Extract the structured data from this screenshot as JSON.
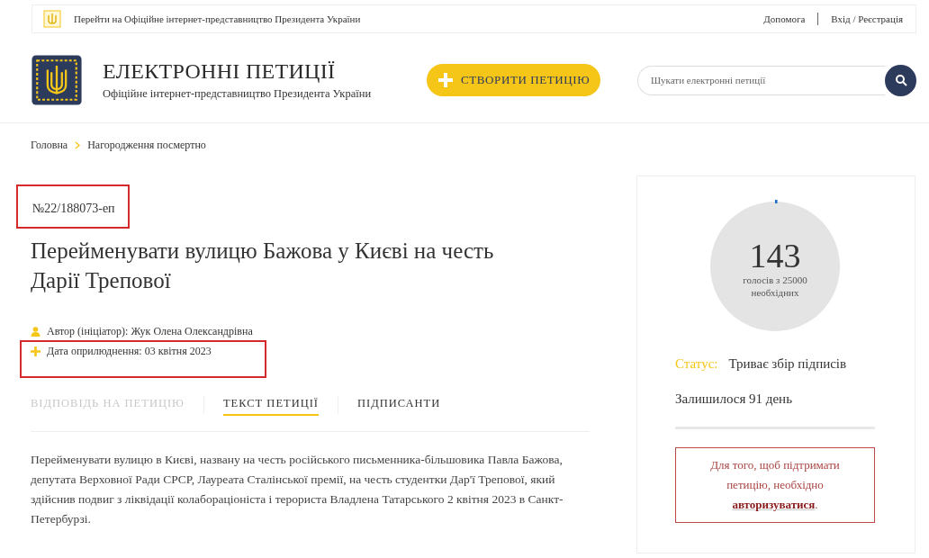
{
  "top_bar": {
    "link": "Перейти на Офіційне інтернет-представництво Президента України",
    "help": "Допомога",
    "login": "Вхід / Реєстрація"
  },
  "header": {
    "title": "ЕЛЕКТРОННІ ПЕТИЦІЇ",
    "subtitle": "Офіційне інтернет-представництво Президента України",
    "create_button": "СТВОРИТИ ПЕТИЦІЮ",
    "search": {
      "placeholder": "Шукати електронні петиції"
    }
  },
  "breadcrumbs": [
    {
      "label": "Головна"
    },
    {
      "label": "Нагородження посмертно"
    }
  ],
  "petition": {
    "number": {
      "text": "№22/188073-еп",
      "highlighted": true
    },
    "title": "Перейменувати вулицю Бажова у Києві на честь Дарії Трепової",
    "meta": [
      {
        "kind": "author",
        "text": "Автор (ініціатор): Жук Олена Олександрівна",
        "highlighted": false
      },
      {
        "kind": "date",
        "text": "Дата оприлюднення: 03 квітня 2023",
        "highlighted": true
      }
    ],
    "tabs": [
      {
        "label": "ВІДПОВІДЬ НА ПЕТИЦІЮ",
        "selected": false,
        "disabled": true
      },
      {
        "label": "ТЕКСТ ПЕТИЦІЇ",
        "selected": true,
        "disabled": false
      },
      {
        "label": "ПІДПИСАНТИ",
        "selected": false,
        "disabled": false
      }
    ],
    "text": "Перейменувати вулицю в Києві, названу на честь російського письменника-більшовика Павла Бажова, депутата Верховної Ради СРСР, Лауреата Сталінської премії, на честь студентки Дар'ї Трепової, який здійснив подвиг з ліквідації колабораціоніста і терориста Владлена Татарського 2 квітня 2023 в Санкт-Петербурзі."
  },
  "sidebar": {
    "votes": {
      "count": "143",
      "caption": "голосів з 25000 необхідних",
      "level": 0.00572
    },
    "status_label": "Статус:",
    "status": "Триває збір підписів",
    "remaining": "Залишилося 91 день",
    "notice": "Для того, щоб підтримати петицію, необхідно **авторизуватися**."
  }
}
